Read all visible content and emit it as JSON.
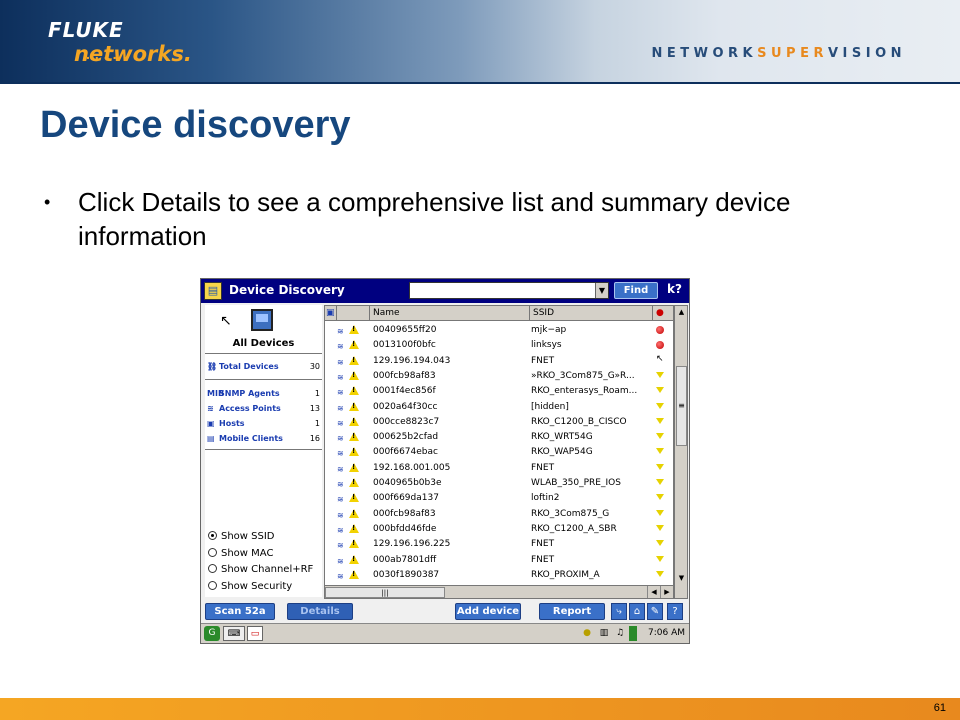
{
  "brand": {
    "fluke": "FLUKE",
    "networks": "networks.",
    "dots": "....",
    "tagline_a": "NETWORK",
    "tagline_b": "SUPER",
    "tagline_c": "VISION"
  },
  "slide": {
    "title": "Device discovery",
    "bullet": "Click Details to see a comprehensive list and summary device information",
    "page_number": "61"
  },
  "app": {
    "title": "Device Discovery",
    "search_value": "",
    "find_label": "Find",
    "help_label": "k?",
    "left_panel": {
      "heading": "All Devices",
      "total": {
        "icon": "total-devices-icon",
        "label": "Total Devices",
        "count": "30"
      },
      "categories": [
        {
          "icon": "snmp-icon",
          "icon_glyph": "MIB",
          "label": "SNMP Agents",
          "count": "1"
        },
        {
          "icon": "access-point-icon",
          "icon_glyph": "≋",
          "label": "Access Points",
          "count": "13"
        },
        {
          "icon": "host-icon",
          "icon_glyph": "▣",
          "label": "Hosts",
          "count": "1"
        },
        {
          "icon": "mobile-client-icon",
          "icon_glyph": "▤",
          "label": "Mobile Clients",
          "count": "16"
        }
      ],
      "view_options": [
        {
          "label": "Show SSID",
          "selected": true
        },
        {
          "label": "Show MAC",
          "selected": false
        },
        {
          "label": "Show Channel+RF",
          "selected": false
        },
        {
          "label": "Show Security",
          "selected": false
        }
      ]
    },
    "table": {
      "columns": [
        "",
        "Name",
        "SSID",
        ""
      ],
      "rows": [
        {
          "name": "00409655ff20",
          "ssid": "mjk−ap",
          "status": "red"
        },
        {
          "name": "0013100f0bfc",
          "ssid": "linksys",
          "status": "red"
        },
        {
          "name": "129.196.194.043",
          "ssid": "FNET",
          "status": "cursor"
        },
        {
          "name": "000fcb98af83",
          "ssid": "»RKO_3Com875_G»R...",
          "status": "yellow"
        },
        {
          "name": "0001f4ec856f",
          "ssid": "RKO_enterasys_Roam...",
          "status": "yellow"
        },
        {
          "name": "0020a64f30cc",
          "ssid": "[hidden]",
          "status": "yellow"
        },
        {
          "name": "000cce8823c7",
          "ssid": "RKO_C1200_B_CISCO",
          "status": "yellow"
        },
        {
          "name": "000625b2cfad",
          "ssid": "RKO_WRT54G",
          "status": "yellow"
        },
        {
          "name": "000f6674ebac",
          "ssid": "RKO_WAP54G",
          "status": "yellow"
        },
        {
          "name": "192.168.001.005",
          "ssid": "FNET",
          "status": "yellow"
        },
        {
          "name": "0040965b0b3e",
          "ssid": "WLAB_350_PRE_IOS",
          "status": "yellow"
        },
        {
          "name": "000f669da137",
          "ssid": "loftin2",
          "status": "yellow"
        },
        {
          "name": "000fcb98af83",
          "ssid": "RKO_3Com875_G",
          "status": "yellow"
        },
        {
          "name": "000bfdd46fde",
          "ssid": "RKO_C1200_A_SBR",
          "status": "yellow"
        },
        {
          "name": "129.196.196.225",
          "ssid": "FNET",
          "status": "yellow"
        },
        {
          "name": "000ab7801dff",
          "ssid": "FNET",
          "status": "yellow"
        },
        {
          "name": "0030f1890387",
          "ssid": "RKO_PROXIM_A",
          "status": "yellow"
        }
      ]
    },
    "buttons": {
      "scan": "Scan 52a",
      "details": "Details",
      "add_device": "Add device",
      "report": "Report"
    },
    "clock": "7:06 AM"
  }
}
